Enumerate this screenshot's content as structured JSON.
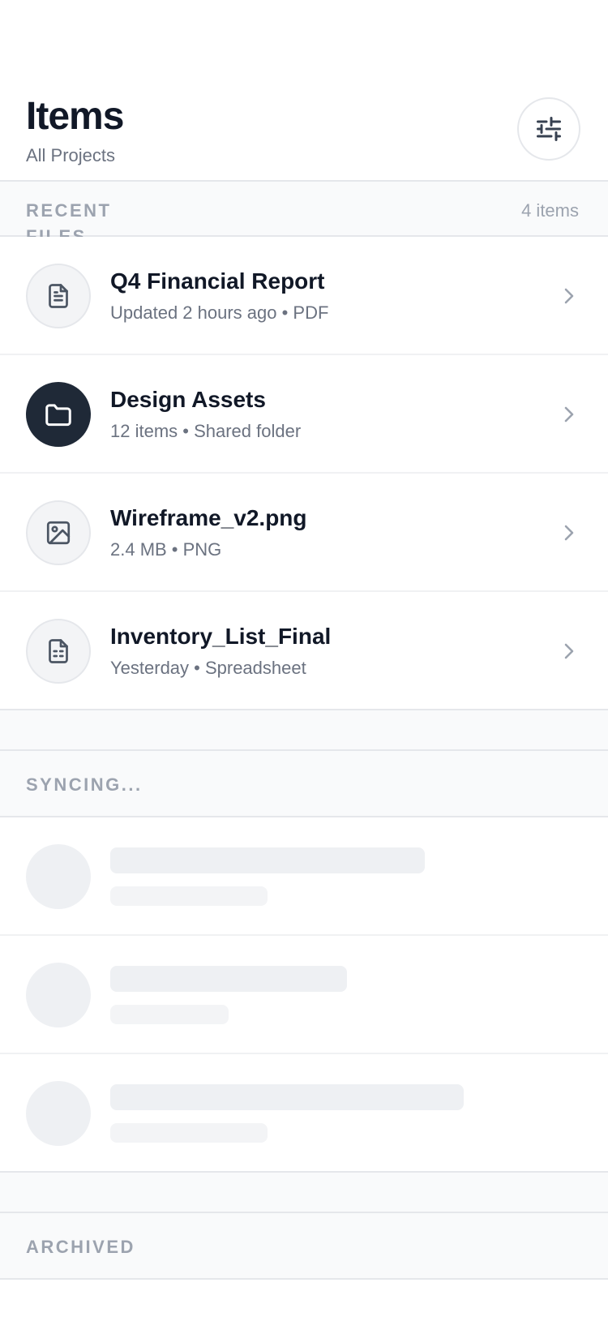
{
  "header": {
    "title": "Items",
    "subtitle": "All Projects",
    "filter_icon": "sliders-icon"
  },
  "sections": {
    "recent": {
      "label": "RECENT FILES",
      "count": "4 items"
    },
    "syncing": {
      "label": "SYNCING..."
    },
    "archived": {
      "label": "ARCHIVED"
    }
  },
  "items": [
    {
      "title": "Q4 Financial Report",
      "subtitle": "Updated 2 hours ago • PDF",
      "icon": "document-icon"
    },
    {
      "title": "Design Assets",
      "subtitle": "12 items • Shared folder",
      "icon": "folder-icon"
    },
    {
      "title": "Wireframe_v2.png",
      "subtitle": "2.4 MB • PNG",
      "icon": "image-icon"
    },
    {
      "title": "Inventory_List_Final",
      "subtitle": "Yesterday • Spreadsheet",
      "icon": "spreadsheet-icon"
    }
  ],
  "colors": {
    "text_primary": "#111827",
    "text_secondary": "#6b7280",
    "muted": "#9ca3af",
    "dark_avatar": "#1f2937",
    "skeleton": "#eef0f3",
    "section_bg": "#f9fafb"
  }
}
